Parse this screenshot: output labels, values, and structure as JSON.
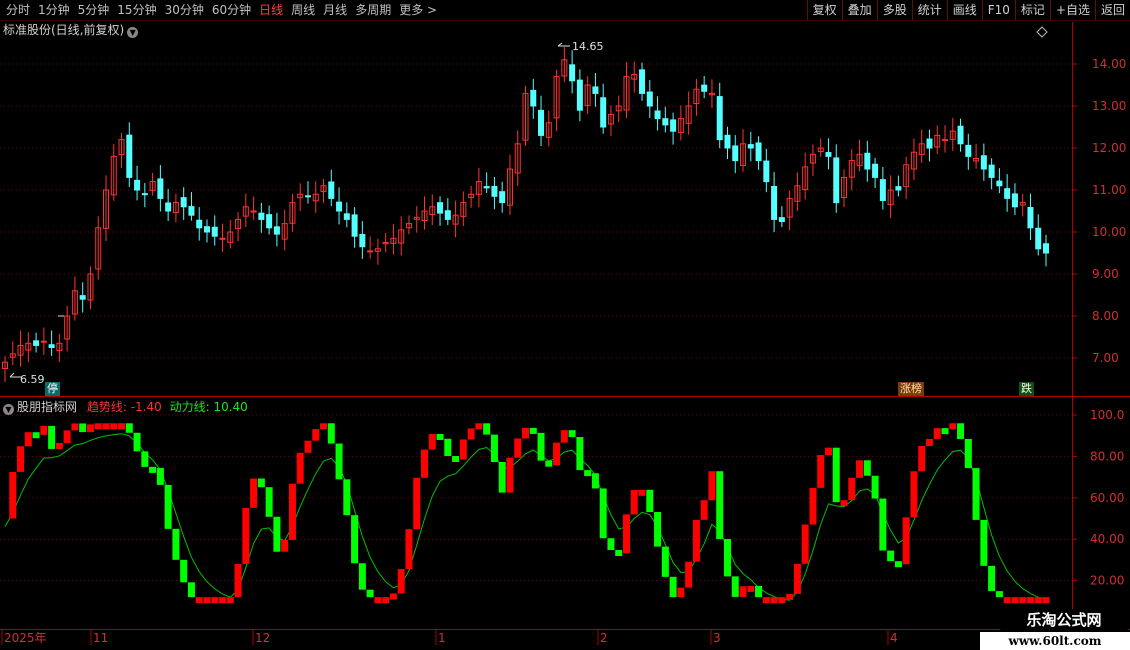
{
  "toolbar": {
    "periods": [
      "分时",
      "1分钟",
      "5分钟",
      "15分钟",
      "30分钟",
      "60分钟",
      "日线",
      "周线",
      "月线",
      "多周期",
      "更多 >"
    ],
    "active_period": "日线",
    "right_buttons": [
      "复权",
      "叠加",
      "多股",
      "统计",
      "画线",
      "F10",
      "标记",
      "+自选",
      "返回"
    ]
  },
  "main_chart": {
    "title": "标准股份(日线,前复权)",
    "high_label": "14.65",
    "low_label": "6.59",
    "y_ticks": [
      "14.00",
      "13.00",
      "12.00",
      "11.00",
      "10.00",
      "9.00",
      "8.00",
      "7.00"
    ],
    "markers": {
      "stop": "停",
      "limit_board": "涨榜",
      "fall": "跌"
    }
  },
  "indicator": {
    "name": "股朋指标网",
    "trend_label": "趋势线: -1.40",
    "power_label": "动力线: 10.40",
    "y_ticks": [
      "100.0",
      "80.00",
      "60.00",
      "40.00",
      "20.00"
    ]
  },
  "x_axis": {
    "labels": [
      "2025年",
      "11",
      "12",
      "1",
      "2",
      "3",
      "4"
    ]
  },
  "watermark": {
    "name": "乐淘公式网",
    "url": "www.60lt.com"
  },
  "colors": {
    "up": "#ff3232",
    "down": "#54ffff",
    "trend_up": "#ff0000",
    "trend_down": "#00ff00",
    "grid": "#7a0000",
    "axis": "#b00000",
    "power": "#00c000"
  },
  "chart_data": {
    "type": "candlestick",
    "x_axis_labels": [
      "2025年",
      "11",
      "12",
      "1",
      "2",
      "3",
      "4"
    ],
    "y_axis_price": [
      "14.00",
      "13.00",
      "12.00",
      "11.00",
      "10.00",
      "9.00",
      "8.00",
      "7.00"
    ],
    "close": [
      6.9,
      7.1,
      7.3,
      7.35,
      7.3,
      7.4,
      7.25,
      7.35,
      8.0,
      8.6,
      8.4,
      9.0,
      10.1,
      11.0,
      11.8,
      12.2,
      11.3,
      11.0,
      10.9,
      11.2,
      10.8,
      10.5,
      10.7,
      10.6,
      10.4,
      10.1,
      10.0,
      9.9,
      9.85,
      10.0,
      10.3,
      10.6,
      10.5,
      10.3,
      10.1,
      9.95,
      10.2,
      10.7,
      10.9,
      10.85,
      10.9,
      11.1,
      10.8,
      10.5,
      10.3,
      9.9,
      9.65,
      9.55,
      9.6,
      9.75,
      9.85,
      10.05,
      10.2,
      10.35,
      10.5,
      10.6,
      10.45,
      10.3,
      10.4,
      10.7,
      10.9,
      11.2,
      11.05,
      10.85,
      10.7,
      11.5,
      12.1,
      13.3,
      13.0,
      12.3,
      12.6,
      13.7,
      14.1,
      13.6,
      12.9,
      13.5,
      13.3,
      12.5,
      12.8,
      13.0,
      13.7,
      13.75,
      13.3,
      13.0,
      12.7,
      12.55,
      12.4,
      12.7,
      13.0,
      13.4,
      13.35,
      13.3,
      12.2,
      12.0,
      11.7,
      12.1,
      12.0,
      11.7,
      11.2,
      10.3,
      10.25,
      10.8,
      11.1,
      11.55,
      11.85,
      12.0,
      11.8,
      10.7,
      11.3,
      11.7,
      11.85,
      11.5,
      11.3,
      10.75,
      11.0,
      11.0,
      11.6,
      11.9,
      12.1,
      12.0,
      12.3,
      12.2,
      12.4,
      12.1,
      11.8,
      11.75,
      11.5,
      11.3,
      11.1,
      10.8,
      10.6,
      10.7,
      10.1,
      9.6,
      9.5
    ]
  }
}
